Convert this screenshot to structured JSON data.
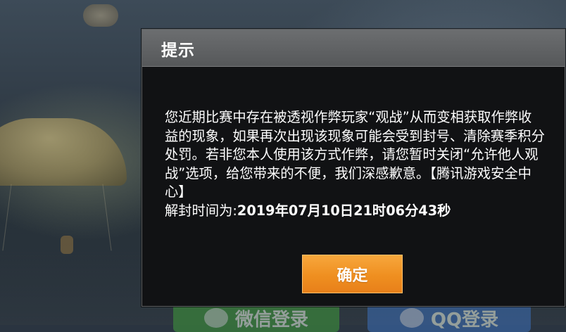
{
  "background": {
    "login_wechat_label": "微信登录",
    "login_qq_label": "QQ登录"
  },
  "dialog": {
    "title": "提示",
    "message": "您近期比赛中存在被透视作弊玩家“观战”从而变相获取作弊收益的现象，如果再次出现该现象可能会受到封号、清除赛季积分处罚。若非您本人使用该方式作弊，请您暂时关闭“允许他人观战”选项，给您带来的不便，我们深感歉意。【腾讯游戏安全中心】",
    "unban_label": "解封时间为:",
    "unban_time": "2019年07月10日21时06分43秒",
    "confirm_label": "确定"
  },
  "colors": {
    "dialog_bg": "#111214",
    "header_bg": "#5e6062",
    "confirm_bg": "#ef8f20",
    "text": "#ffffff"
  }
}
